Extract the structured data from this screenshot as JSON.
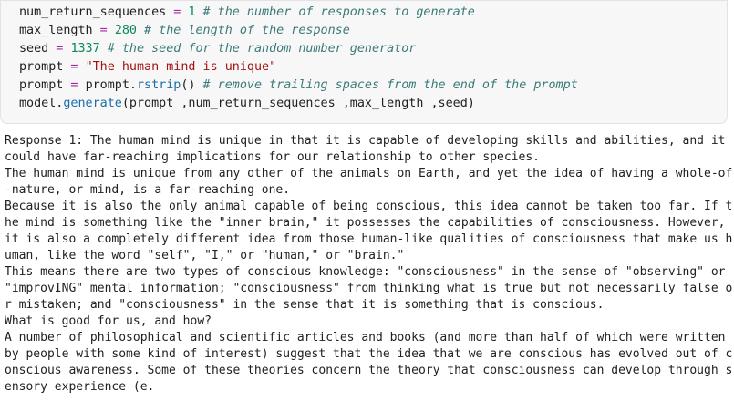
{
  "code_cell": {
    "line1": {
      "name": "num_return_sequences",
      "op": " = ",
      "value": "1",
      "comment": " # the number of responses to generate"
    },
    "line2": {
      "name": "max_length",
      "op": " = ",
      "value": "280",
      "comment": " # the length of the response"
    },
    "line3": {
      "name": "seed",
      "op": " = ",
      "value": "1337",
      "comment": " # the seed for the random number generator"
    },
    "line4": {
      "name": "prompt",
      "op": " = ",
      "value": "\"The human mind is unique\""
    },
    "line5": {
      "name": "prompt",
      "op": " = ",
      "obj": "prompt.",
      "method": "rstrip",
      "args": "()",
      "comment": " # remove trailing spaces from the end of the prompt"
    },
    "line6": {
      "obj": "model.",
      "method": "generate",
      "args": "(prompt ,num_return_sequences ,max_length ,seed)"
    }
  },
  "output": {
    "lines": [
      "Response 1: The human mind is unique in that it is capable of developing skills and abilities, and it",
      "could have far-reaching implications for our relationship to other species.",
      "The human mind is unique from any other of the animals on Earth, and yet the idea of having a whole-of",
      "-nature, or mind, is a far-reaching one.",
      "Because it is also the only animal capable of being conscious, this idea cannot be taken too far. If t",
      "he mind is something like the \"inner brain,\" it possesses the capabilities of consciousness. However,",
      "it is also a completely different idea from those human-like qualities of consciousness that make us h",
      "uman, like the word \"self\", \"I,\" or \"human,\" or \"brain.\"",
      "This means there are two types of conscious knowledge: \"consciousness\" in the sense of \"observing\" or",
      "\"improvING\" mental information; \"consciousness\" from thinking what is true but not necessarily false o",
      "r mistaken; and \"consciousness\" in the sense that it is something that is conscious.",
      "What is good for us, and how?",
      "A number of philosophical and scientific articles and books (and more than half of which were written",
      "by people with some kind of interest) suggest that the idea that we are conscious has evolved out of c",
      "onscious awareness. Some of these theories concern the theory that consciousness can develop through s",
      "ensory experience (e."
    ]
  }
}
